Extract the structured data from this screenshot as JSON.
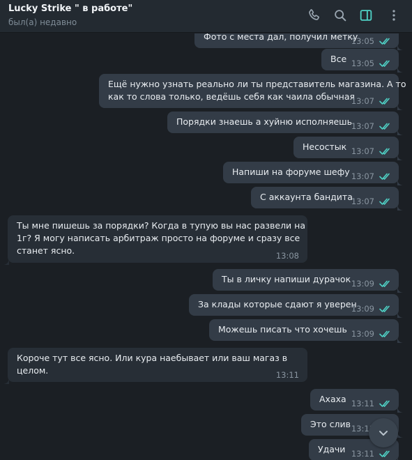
{
  "header": {
    "title": "Lucky Strike \" в работе\"",
    "status": "был(а) недавно",
    "icons": [
      "phone-icon",
      "search-icon",
      "sidebar-toggle-icon",
      "more-vertical-icon"
    ],
    "accent_color": "#4fd1c5"
  },
  "messages": [
    {
      "dir": "out",
      "text": "Фото с места дал, получил метку",
      "time": "13:05"
    },
    {
      "dir": "out",
      "text": "Все",
      "time": "13:05"
    },
    {
      "dir": "out",
      "lines": [
        "Ещё нужно узнать реально ли ты представитель магазина. А то",
        "как то слова только, ведёшь себя как чаила обычная"
      ],
      "time": "13:07"
    },
    {
      "dir": "out",
      "text": "Порядки знаешь а хуйню исполняешь",
      "time": "13:07"
    },
    {
      "dir": "out",
      "text": "Несостык",
      "time": "13:07"
    },
    {
      "dir": "out",
      "text": "Напиши на форуме шефу",
      "time": "13:07"
    },
    {
      "dir": "out",
      "text": "С аккаунта бандита",
      "time": "13:07"
    },
    {
      "dir": "in",
      "lines": [
        "Ты мне пишешь за порядки? Когда в тупую вы нас развели на",
        "1г? Я могу написать арбитраж просто на форуме и сразу все",
        "станет ясно."
      ],
      "time": "13:08"
    },
    {
      "dir": "out",
      "text": "Ты в личку напиши дурачок",
      "time": "13:09"
    },
    {
      "dir": "out",
      "text": "За клады которые сдают я уверен",
      "time": "13:09"
    },
    {
      "dir": "out",
      "text": "Можешь писать что хочешь",
      "time": "13:09"
    },
    {
      "dir": "in",
      "lines": [
        "Короче тут все ясно. Или кура наебывает или ваш магаз в",
        "целом."
      ],
      "time": "13:11"
    },
    {
      "dir": "out",
      "text": "Ахаха",
      "time": "13:11"
    },
    {
      "dir": "out",
      "text": "Это слив",
      "time": "13:11"
    },
    {
      "dir": "out",
      "text": "Удачи",
      "time": "13:11"
    }
  ]
}
